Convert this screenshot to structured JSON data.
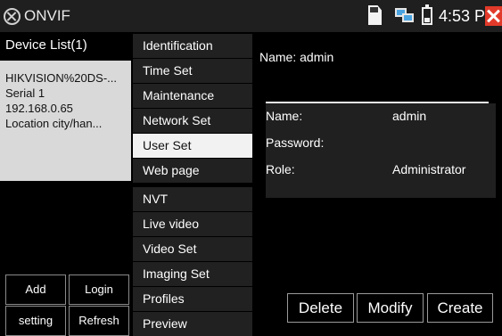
{
  "app": {
    "title": "ONVIF",
    "icon": "onvif-app-icon"
  },
  "status_bar": {
    "time": "4:53 PM",
    "icons": [
      "sd-card-icon",
      "network-icon",
      "battery-icon",
      "close-icon"
    ],
    "close_color": "#e23a2a"
  },
  "device_list": {
    "header": "Device List(1)",
    "devices": [
      {
        "name": "HIKVISION%20DS-...",
        "serial": "Serial 1",
        "ip": "192.168.0.65",
        "location": "Location city/han..."
      }
    ],
    "buttons": {
      "add": "Add",
      "login": "Login",
      "setting": "setting",
      "refresh": "Refresh"
    }
  },
  "menu": {
    "items": [
      "Identification",
      "Time Set",
      "Maintenance",
      "Network Set",
      "User Set",
      "Web page",
      "NVT",
      "Live video",
      "Video Set",
      "Imaging Set",
      "Profiles",
      "Preview"
    ],
    "selected": "User Set"
  },
  "user_panel": {
    "name_heading": "Name: admin",
    "rows": [
      {
        "key": "Name:",
        "value": "admin"
      },
      {
        "key": "Password:",
        "value": ""
      },
      {
        "key": "Role:",
        "value": "Administrator"
      }
    ],
    "buttons": {
      "delete": "Delete",
      "modify": "Modify",
      "create": "Create"
    }
  }
}
